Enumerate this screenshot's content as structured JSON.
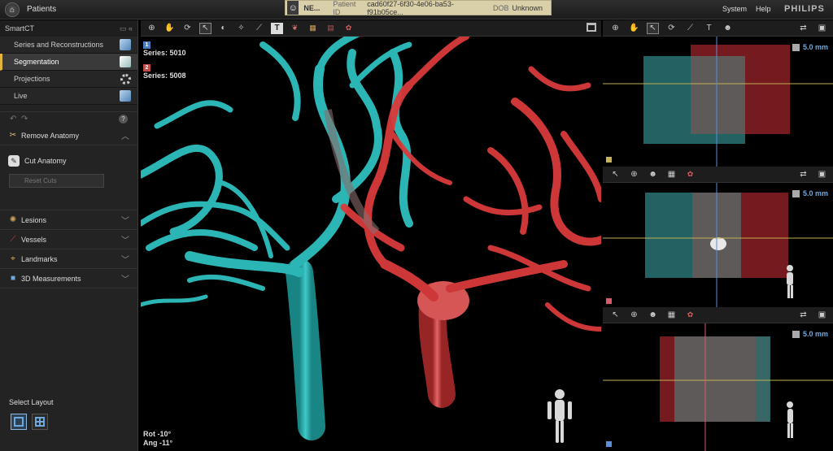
{
  "topbar": {
    "patients_label": "Patients",
    "patient_name": "NE...",
    "patient_id_label": "Patient ID",
    "patient_id": "cad60f27-6f30-4e06-ba53-f91b05ce...",
    "dob_label": "DOB",
    "dob": "Unknown",
    "system": "System",
    "help": "Help",
    "brand": "PHILIPS"
  },
  "left_panel": {
    "app_name": "SmartCT",
    "nav": [
      {
        "label": "Series and Reconstructions",
        "icon": "cube-icon",
        "active": false
      },
      {
        "label": "Segmentation",
        "icon": "segmentation-cube-icon",
        "active": true
      },
      {
        "label": "Projections",
        "icon": "rotation-icon",
        "active": false
      },
      {
        "label": "Live",
        "icon": "live-cube-icon",
        "active": false
      }
    ],
    "help_glyph": "?",
    "remove_anatomy": "Remove Anatomy",
    "cut_anatomy": "Cut Anatomy",
    "reset_cuts": "Reset Cuts",
    "lesions": "Lesions",
    "vessels": "Vessels",
    "landmarks": "Landmarks",
    "measurements": "3D Measurements",
    "select_layout": "Select Layout"
  },
  "main_view": {
    "series_1_num": "1",
    "series_1": "Series: 5010",
    "series_2_num": "2",
    "series_2": "Series: 5008",
    "rot": "Rot -10°",
    "ang": "Ang -11°"
  },
  "right_views": {
    "thickness_1": "5.0 mm",
    "thickness_2": "5.0 mm",
    "thickness_3": "5.0 mm"
  },
  "colors": {
    "accent_active": "#e3b53c",
    "cyan_volume": "#2fbfbf",
    "red_volume": "#d93a3a",
    "marker_1": "#c8b25a",
    "marker_2": "#d95a6a",
    "marker_3": "#5a8fd9"
  }
}
